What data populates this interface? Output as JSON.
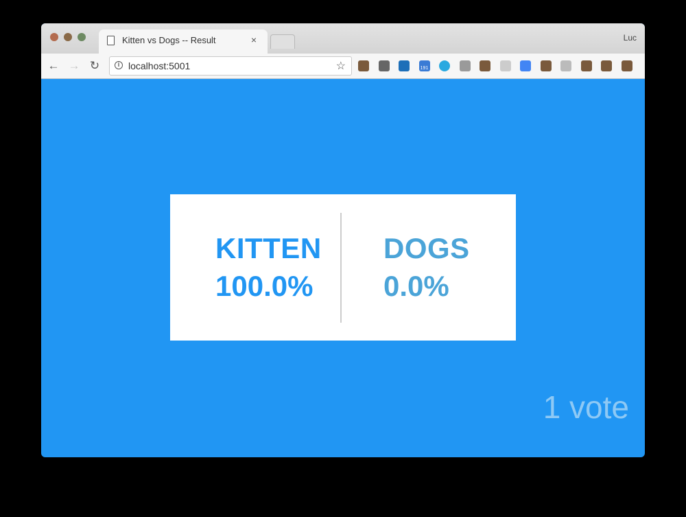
{
  "browser": {
    "tab_title": "Kitten vs Dogs -- Result",
    "tab_close": "×",
    "profile_name": "Luc",
    "url": "localhost:5001",
    "nav": {
      "back": "←",
      "forward": "→",
      "reload": "↻"
    },
    "info_glyph": "i",
    "star_glyph": "☆",
    "extensions": [
      {
        "icon": "amazon-assistant-icon",
        "color": "#7a5a3c"
      },
      {
        "icon": "cast-icon",
        "color": "#666666"
      },
      {
        "icon": "y-icon",
        "color": "#1e6fb8"
      },
      {
        "icon": "counter-badge-icon",
        "color": "#3a7bd5",
        "label": "191"
      },
      {
        "icon": "blue-circle-icon",
        "color": "#2aa9e0"
      },
      {
        "icon": "drive-icon",
        "color": "#9a9a9a"
      },
      {
        "icon": "lock-icon",
        "color": "#7a5a3c"
      },
      {
        "icon": "ex-icon",
        "color": "#cccccc"
      },
      {
        "icon": "translate-icon",
        "color": "#4285f4"
      },
      {
        "icon": "p-icon",
        "color": "#7a5a3c"
      },
      {
        "icon": "clipboard-icon",
        "color": "#bbbbbb"
      },
      {
        "icon": "diamond-icon",
        "color": "#7a5a3c"
      },
      {
        "icon": "phone-icon",
        "color": "#7a5a3c"
      },
      {
        "icon": "alert-icon",
        "color": "#7a5a3c"
      }
    ]
  },
  "result": {
    "options": [
      {
        "label": "KITTEN",
        "percent": "100.0%",
        "color": "#2196f3"
      },
      {
        "label": "DOGS",
        "percent": "0.0%",
        "color": "#4ba4d8"
      }
    ],
    "votes_text": "1 vote"
  },
  "colors": {
    "page_background": "#2196f3",
    "card_background": "#ffffff"
  }
}
